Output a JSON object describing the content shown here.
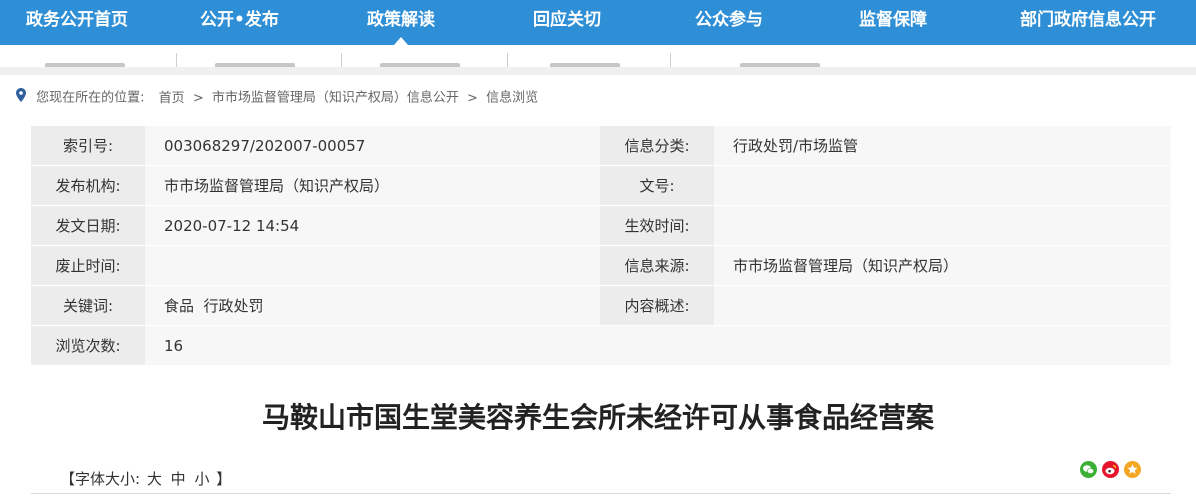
{
  "nav": {
    "items": [
      {
        "label": "政务公开首页"
      },
      {
        "label": "公开•发布"
      },
      {
        "label": "政策解读"
      },
      {
        "label": "回应关切"
      },
      {
        "label": "公众参与"
      },
      {
        "label": "监督保障"
      },
      {
        "label": "部门政府信息公开"
      }
    ],
    "active_index": 2
  },
  "breadcrumb": {
    "prefix": "您现在所在的位置:",
    "home": "首页",
    "sep": ">",
    "dept": "市市场监督管理局（知识产权局）信息公开",
    "current": "信息浏览"
  },
  "info": {
    "rows": [
      {
        "l1": "索引号:",
        "v1": "003068297/202007-00057",
        "l2": "信息分类:",
        "v2": "行政处罚/市场监管"
      },
      {
        "l1": "发布机构:",
        "v1": "市市场监督管理局（知识产权局）",
        "l2": "文号:",
        "v2": ""
      },
      {
        "l1": "发文日期:",
        "v1": "2020-07-12 14:54",
        "l2": "生效时间:",
        "v2": ""
      },
      {
        "l1": "废止时间:",
        "v1": "",
        "l2": "信息来源:",
        "v2": "市市场监督管理局（知识产权局）"
      },
      {
        "l1": "关键词:",
        "v1": "食品  行政处罚",
        "l2": "内容概述:",
        "v2": ""
      },
      {
        "l1": "浏览次数:",
        "v1": "16"
      }
    ]
  },
  "article": {
    "title": "马鞍山市国生堂美容养生会所未经许可从事食品经营案"
  },
  "fontbar": {
    "prefix": "【字体大小:",
    "large": "大",
    "medium": "中",
    "small": "小",
    "suffix": "】"
  },
  "share": {
    "icons": [
      "wechat-icon",
      "weibo-icon",
      "favorite-icon"
    ],
    "colors": {
      "wechat": "#3cb034",
      "weibo": "#e6162d",
      "favorite": "#f5a623"
    }
  },
  "colors": {
    "nav_bg": "#2f8fd6",
    "label_bg": "#ececec",
    "value_bg": "#f7f7f7"
  }
}
